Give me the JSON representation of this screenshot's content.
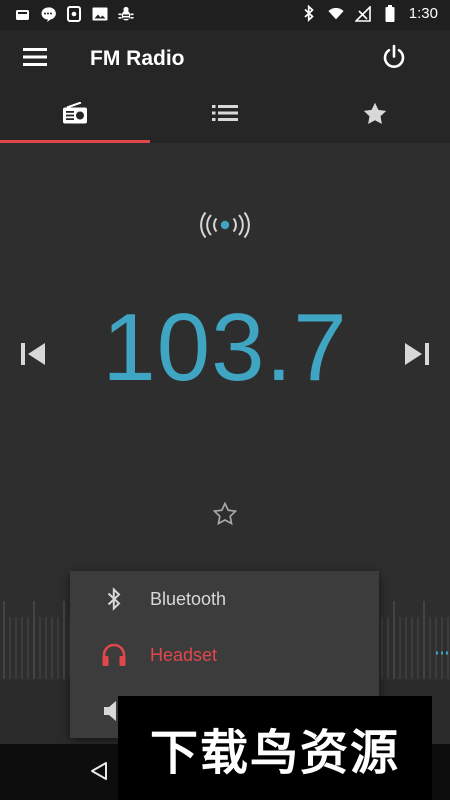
{
  "status_bar": {
    "time": "1:30",
    "left_icons": [
      "sim-icon",
      "chat-icon",
      "screenshot-icon",
      "image-icon",
      "bug-icon"
    ],
    "right_icons": [
      "bluetooth-icon",
      "wifi-icon",
      "signal-icon",
      "battery-icon"
    ]
  },
  "app_bar": {
    "title": "FM Radio",
    "menu_icon": "menu-icon",
    "power_icon": "power-icon"
  },
  "tabs": [
    {
      "name": "radio",
      "icon": "radio-icon",
      "active": true
    },
    {
      "name": "station-list",
      "icon": "list-icon",
      "active": false
    },
    {
      "name": "favorites",
      "icon": "star-icon",
      "active": false
    }
  ],
  "player": {
    "frequency": "103.7",
    "prev_icon": "skip-previous-icon",
    "next_icon": "skip-next-icon",
    "favorite_icon": "star-outline-icon"
  },
  "audio_output_menu": {
    "items": [
      {
        "label": "Bluetooth",
        "icon": "bluetooth-icon",
        "active": false
      },
      {
        "label": "Headset",
        "icon": "headset-icon",
        "active": true
      },
      {
        "label": "",
        "icon": "speaker-icon",
        "active": false
      }
    ]
  },
  "nav_bar": {
    "back_icon": "back-icon"
  },
  "watermark": {
    "text": "下载鸟资源"
  },
  "colors": {
    "accent": "#e0474c",
    "frequency": "#3fa5c2",
    "background": "#2e2e2e",
    "app_bar": "#262626"
  }
}
